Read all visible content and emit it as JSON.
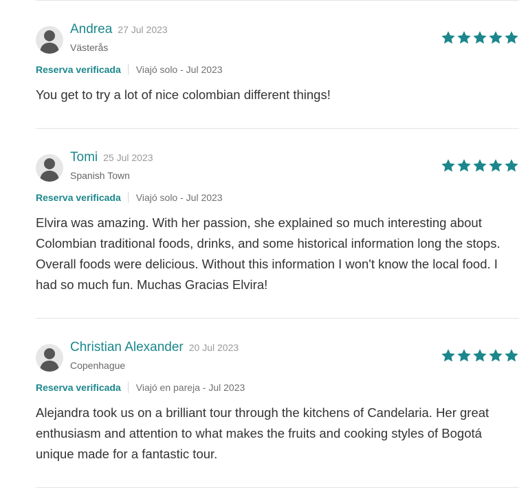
{
  "reviews": [
    {
      "name": "Andrea",
      "date": "27 Jul 2023",
      "location": "Västerås",
      "verified": "Reserva verificada",
      "trip": "Viajó solo - Jul 2023",
      "rating": 5,
      "text": "You get to try a lot of nice colombian different things!"
    },
    {
      "name": "Tomi",
      "date": "25 Jul 2023",
      "location": "Spanish Town",
      "verified": "Reserva verificada",
      "trip": "Viajó solo - Jul 2023",
      "rating": 5,
      "text": "Elvira was amazing. With her passion, she explained so much interesting about Colombian traditional foods, drinks, and some historical information long the stops. Overall foods were delicious. Without this information I won't know the local food. I had so much fun. Muchas Gracias Elvira!"
    },
    {
      "name": "Christian Alexander",
      "date": "20 Jul 2023",
      "location": "Copenhague",
      "verified": "Reserva verificada",
      "trip": "Viajó en pareja - Jul 2023",
      "rating": 5,
      "text": "Alejandra took us on a brilliant tour through the kitchens of Candelaria. Her great enthusiasm and attention to what makes the fruits and cooking styles of Bogotá unique made for a fantastic tour."
    }
  ],
  "colors": {
    "accent": "#1b878c",
    "divider": "#e3e3e3"
  },
  "icons": {
    "avatar": "user-silhouette-icon",
    "rating": "star-icon"
  }
}
